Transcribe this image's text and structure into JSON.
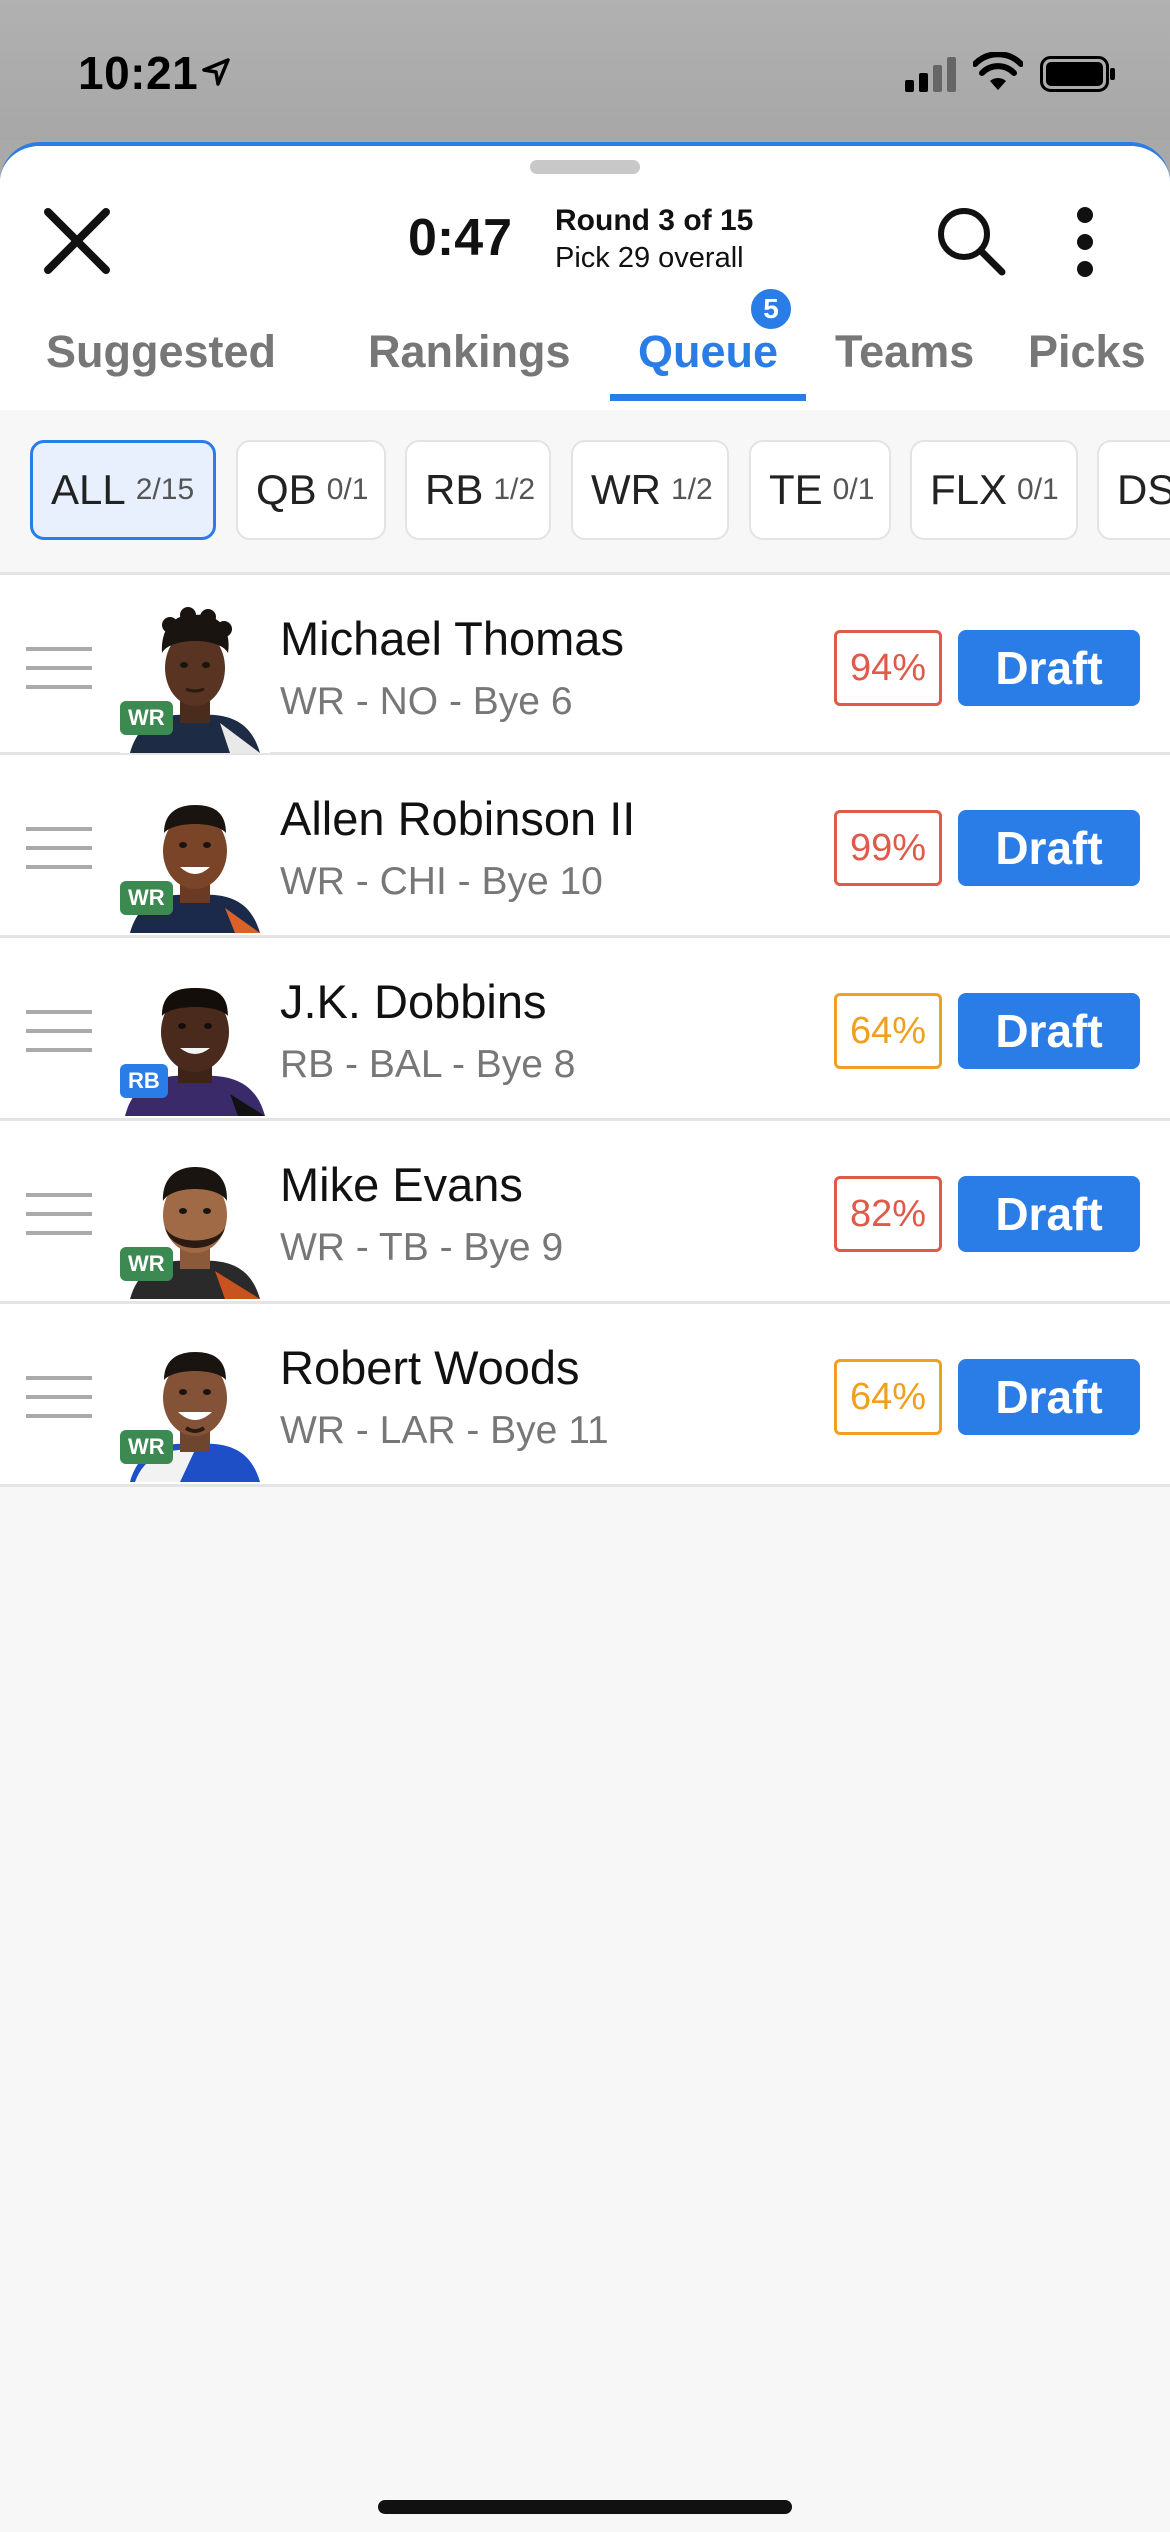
{
  "status_bar": {
    "time": "10:21"
  },
  "header": {
    "timer": "0:47",
    "round": "Round 3 of 15",
    "pick": "Pick 29 overall"
  },
  "tabs": [
    {
      "label": "Suggested"
    },
    {
      "label": "Rankings"
    },
    {
      "label": "Queue",
      "badge": "5"
    },
    {
      "label": "Teams"
    },
    {
      "label": "Picks"
    }
  ],
  "filters": [
    {
      "label": "ALL",
      "count": "2/15"
    },
    {
      "label": "QB",
      "count": "0/1"
    },
    {
      "label": "RB",
      "count": "1/2"
    },
    {
      "label": "WR",
      "count": "1/2"
    },
    {
      "label": "TE",
      "count": "0/1"
    },
    {
      "label": "FLX",
      "count": "0/1"
    },
    {
      "label": "DS",
      "count": ""
    }
  ],
  "players": [
    {
      "name": "Michael Thomas",
      "meta": "WR - NO - Bye 6",
      "pos": "WR",
      "pct": "94%",
      "action": "Draft"
    },
    {
      "name": "Allen Robinson II",
      "meta": "WR - CHI - Bye 10",
      "pos": "WR",
      "pct": "99%",
      "action": "Draft"
    },
    {
      "name": "J.K. Dobbins",
      "meta": "RB - BAL - Bye 8",
      "pos": "RB",
      "pct": "64%",
      "action": "Draft"
    },
    {
      "name": "Mike Evans",
      "meta": "WR - TB - Bye 9",
      "pos": "WR",
      "pct": "82%",
      "action": "Draft"
    },
    {
      "name": "Robert Woods",
      "meta": "WR - LAR - Bye 11",
      "pos": "WR",
      "pct": "64%",
      "action": "Draft"
    }
  ],
  "colors": {
    "accent": "#2a7ce6",
    "wr_badge": "#3c8a52",
    "rb_badge": "#2a7ce6",
    "pct_red": "#e05a4a",
    "pct_orange": "#f0a020"
  }
}
